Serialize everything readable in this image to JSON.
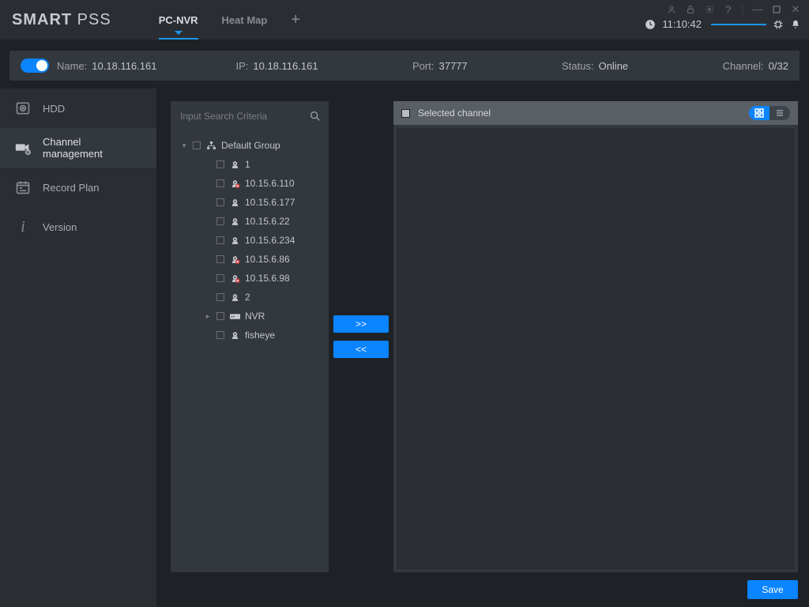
{
  "app": {
    "logo_a": "SMART",
    "logo_b": " PSS"
  },
  "tabs": [
    {
      "label": "PC-NVR",
      "active": true
    },
    {
      "label": "Heat Map",
      "active": false
    }
  ],
  "clock": "11:10:42",
  "device": {
    "name_label": "Name:",
    "name": "10.18.116.161",
    "ip_label": "IP:",
    "ip": "10.18.116.161",
    "port_label": "Port:",
    "port": "37777",
    "status_label": "Status:",
    "status": "Online",
    "channel_label": "Channel:",
    "channel": "0/32"
  },
  "sidebar": [
    {
      "label": "HDD",
      "icon": "disk"
    },
    {
      "label": "Channel management",
      "icon": "camera"
    },
    {
      "label": "Record Plan",
      "icon": "calendar"
    },
    {
      "label": "Version",
      "icon": "info"
    }
  ],
  "sidebar_active": 1,
  "search_placeholder": "Input Search Criteria",
  "tree": {
    "root": {
      "label": "Default Group",
      "expanded": true
    },
    "children": [
      {
        "label": "1",
        "icon": "cam"
      },
      {
        "label": "10.15.6.110",
        "icon": "cam-err"
      },
      {
        "label": "10.15.6.177",
        "icon": "cam"
      },
      {
        "label": "10.15.6.22",
        "icon": "cam"
      },
      {
        "label": "10.15.6.234",
        "icon": "cam"
      },
      {
        "label": "10.15.6.86",
        "icon": "cam-err"
      },
      {
        "label": "10.15.6.98",
        "icon": "cam-err"
      },
      {
        "label": "2",
        "icon": "cam"
      },
      {
        "label": "NVR",
        "icon": "nvr",
        "expandable": true
      },
      {
        "label": "fisheye",
        "icon": "cam"
      }
    ]
  },
  "transfer": {
    "add": ">>",
    "remove": "<<"
  },
  "right": {
    "header": "Selected channel"
  },
  "buttons": {
    "save": "Save"
  }
}
